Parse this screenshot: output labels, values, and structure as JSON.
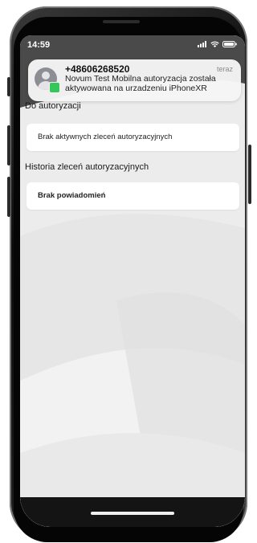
{
  "status_bar": {
    "time": "14:59"
  },
  "notification": {
    "title": "+48606268520",
    "time": "teraz",
    "body": "Novum Test Mobilna autoryzacja została aktywowana na urzadzeniu iPhoneXR"
  },
  "sections": {
    "authorization": {
      "title": "Do autoryzacji",
      "empty_text": "Brak aktywnych zleceń autoryzacyjnych"
    },
    "history": {
      "title": "Historia zleceń autoryzacyjnych",
      "empty_text": "Brak powiadomień"
    }
  },
  "colors": {
    "screen_background": "#ececec",
    "card_background": "#ffffff",
    "message_badge": "#34c759"
  },
  "icons": [
    "contact-avatar-icon",
    "messages-badge-icon",
    "signal-icon",
    "wifi-icon",
    "battery-icon"
  ]
}
